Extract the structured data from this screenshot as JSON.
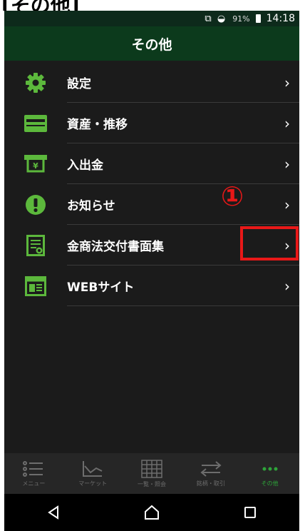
{
  "top_heading_fragment": "[その他]",
  "status_bar": {
    "signal_icons": "⧉ ◒",
    "battery_percent": "91%",
    "time": "14:18"
  },
  "header": {
    "title": "その他"
  },
  "menu": {
    "items": [
      {
        "label": "設定",
        "icon": "gear-icon"
      },
      {
        "label": "資産・推移",
        "icon": "card-icon"
      },
      {
        "label": "入出金",
        "icon": "atm-icon"
      },
      {
        "label": "お知らせ",
        "icon": "exclamation-icon"
      },
      {
        "label": "金商法交付書面集",
        "icon": "document-icon"
      },
      {
        "label": "WEBサイト",
        "icon": "web-icon"
      }
    ],
    "chevron": "›"
  },
  "annotation": {
    "number": "①",
    "color": "#e81818"
  },
  "bottom_nav": {
    "items": [
      {
        "label": "メニュー",
        "icon": "menu-list-icon"
      },
      {
        "label": "マーケット",
        "icon": "chart-icon"
      },
      {
        "label": "一覧・照会",
        "icon": "grid-icon"
      },
      {
        "label": "銘柄・取引",
        "icon": "swap-icon"
      },
      {
        "label": "その他",
        "icon": "more-dots-icon",
        "active": true
      }
    ]
  },
  "colors": {
    "header_bg": "#0c3a1c",
    "accent_green": "#5cb83c",
    "active_nav": "#2ea43a",
    "background": "#1b1b1b"
  }
}
